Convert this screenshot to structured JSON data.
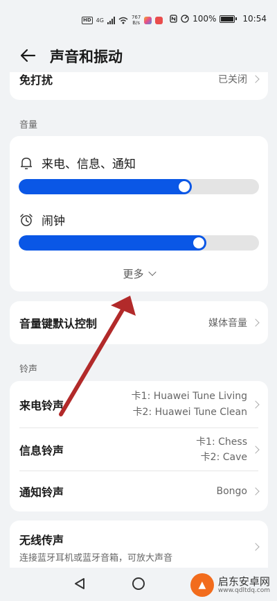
{
  "status": {
    "network": "4G",
    "speed_value": "767",
    "speed_unit": "B/s",
    "battery": "100%",
    "time": "10:54"
  },
  "header": {
    "title": "声音和振动",
    "back_icon": "arrow-left-icon"
  },
  "dnd": {
    "label": "免打扰",
    "value": "已关闭"
  },
  "volume": {
    "section_label": "音量",
    "items": [
      {
        "label": "来电、信息、通知",
        "icon": "bell-icon",
        "level": 0.72
      },
      {
        "label": "闹钟",
        "icon": "alarm-clock-icon",
        "level": 0.78
      }
    ],
    "more_label": "更多",
    "accent": "#0a57e6"
  },
  "volume_key": {
    "label": "音量键默认控制",
    "value": "媒体音量"
  },
  "ringtone": {
    "section_label": "铃声",
    "call": {
      "label": "来电铃声",
      "line1": "卡1: Huawei Tune Living",
      "line2": "卡2: Huawei Tune Clean"
    },
    "message": {
      "label": "信息铃声",
      "line1": "卡1: Chess",
      "line2": "卡2: Cave"
    },
    "notify": {
      "label": "通知铃声",
      "value": "Bongo"
    }
  },
  "wireless": {
    "label": "无线传声",
    "desc": "连接蓝牙耳机或蓝牙音箱，可放大声音"
  },
  "watermark": {
    "text": "启东安卓网",
    "url": "www.qdltdq.com"
  }
}
